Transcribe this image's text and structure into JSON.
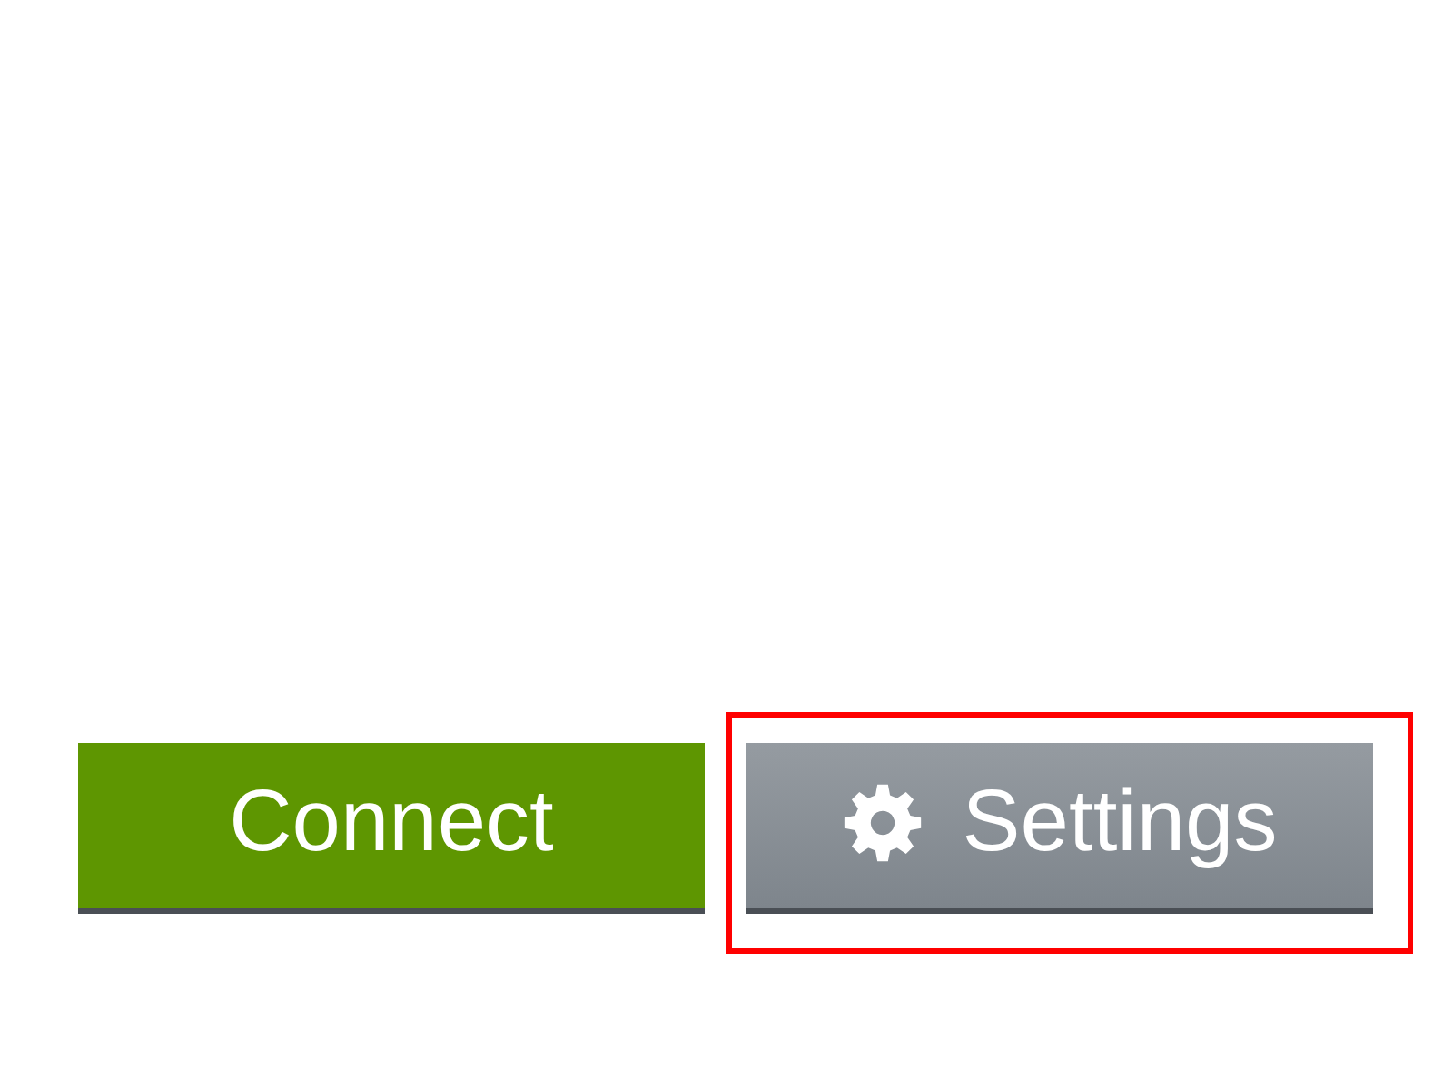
{
  "buttons": [
    {
      "label": "Connect",
      "kind": "primary",
      "highlighted": false
    },
    {
      "label": "Settings",
      "kind": "secondary",
      "highlighted": true
    }
  ]
}
